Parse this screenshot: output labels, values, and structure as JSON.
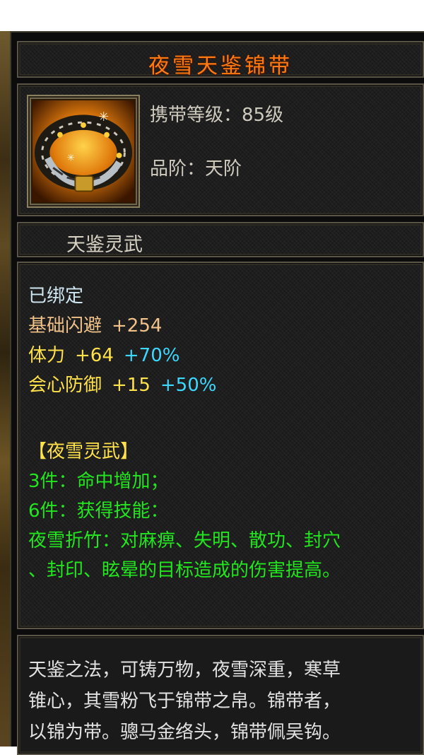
{
  "item": {
    "name": "夜雪天鉴锦带",
    "icon": "belt-item-icon",
    "level_req": "携带等级：85级",
    "grade": "品阶：天阶",
    "series": "天鉴灵武"
  },
  "attributes": {
    "bound": "已绑定",
    "dodge_label": "基础闪避",
    "dodge_value": "+254",
    "stamina_label": "体力",
    "stamina_value": "+64",
    "stamina_pct": "+70%",
    "crit_def_label": "会心防御",
    "crit_def_value": "+15",
    "crit_def_pct": "+50%"
  },
  "set": {
    "name": "【夜雪灵武】",
    "bonus_3": "3件：命中增加；",
    "bonus_6": "6件：获得技能：",
    "skill_line1": "夜雪折竹：对麻痹、失明、散功、封穴",
    "skill_line2": "、封印、眩晕的目标造成的伤害提高。"
  },
  "description": "天鉴之法，可铸万物，夜雪深重，寒草\n锥心，其雪粉飞于锦带之帛。锦带者，\n以锦为带。骢马金络头，锦带佩吴钩。",
  "colors": {
    "title": "#ff7a10",
    "bound": "#cfe7f0",
    "base_stat": "#f0c28a",
    "stat_yellow": "#ffe14a",
    "percent": "#3cd8ff",
    "set_text": "#22e61e"
  }
}
